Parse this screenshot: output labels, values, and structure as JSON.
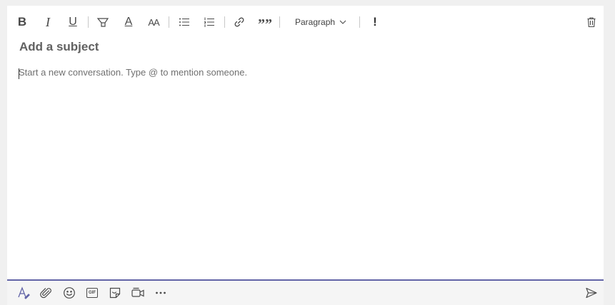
{
  "toolbar": {
    "bold_glyph": "B",
    "italic_glyph": "I",
    "underline_glyph": "U",
    "font_color_glyph": "A",
    "font_size_glyph": "AA",
    "quote_glyph": "””",
    "important_glyph": "!",
    "paragraph_label": "Paragraph",
    "icons": [
      "bold-icon",
      "italic-icon",
      "underline-icon",
      "highlight-icon",
      "font-color-icon",
      "font-size-icon",
      "bulleted-list-icon",
      "numbered-list-icon",
      "link-icon",
      "quote-icon",
      "chevron-down-icon",
      "important-icon",
      "trash-icon"
    ]
  },
  "compose": {
    "subject_placeholder": "Add a subject",
    "message_placeholder": "Start a new conversation. Type @ to mention someone."
  },
  "bottombar": {
    "icons": [
      "format-icon",
      "attach-icon",
      "emoji-icon",
      "gif-icon",
      "sticker-icon",
      "meet-now-icon",
      "more-options-icon",
      "send-icon"
    ],
    "gif_label": "GIF"
  },
  "colors": {
    "accent": "#6264a7",
    "background": "#f0f0f0",
    "surface": "#ffffff",
    "icon": "#4a4a4a"
  }
}
